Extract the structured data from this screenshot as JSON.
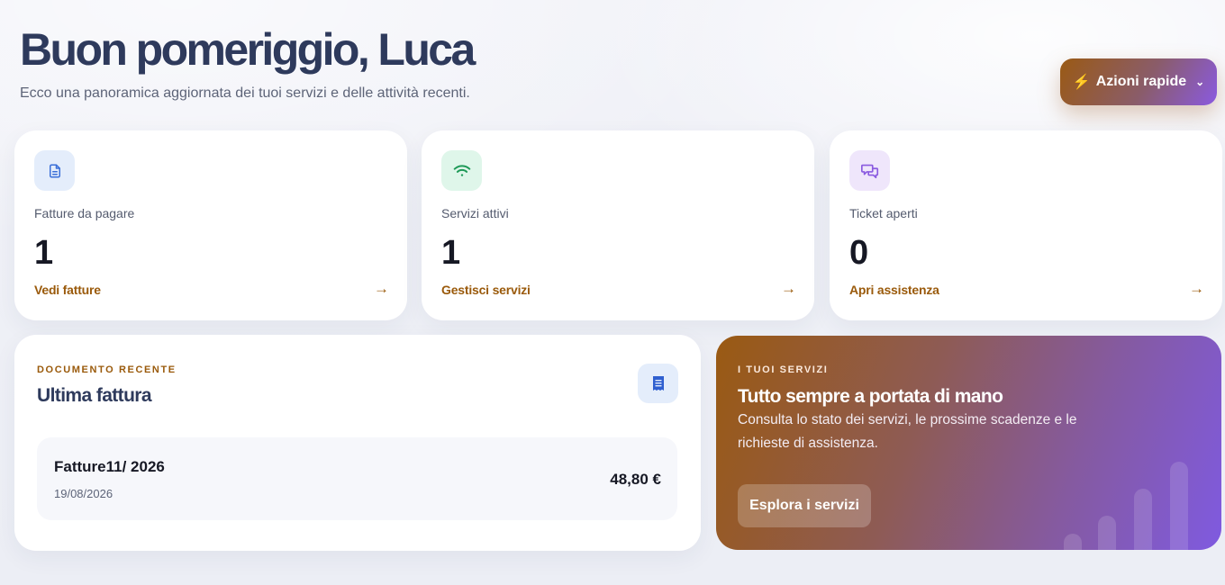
{
  "header": {
    "greeting": "Buon pomeriggio, Luca",
    "subtitle": "Ecco una panoramica aggiornata dei tuoi servizi e delle attività recenti.",
    "quick_actions_label": "Azioni rapide"
  },
  "stats": [
    {
      "label": "Fatture da pagare",
      "value": "1",
      "link": "Vedi fatture",
      "icon": "document-icon",
      "icon_bg": "#e4edfb",
      "icon_color": "#3a6fd8"
    },
    {
      "label": "Servizi attivi",
      "value": "1",
      "link": "Gestisci servizi",
      "icon": "wifi-icon",
      "icon_bg": "#dff6ea",
      "icon_color": "#1f9a58"
    },
    {
      "label": "Ticket aperti",
      "value": "0",
      "link": "Apri assistenza",
      "icon": "chat-bubbles-icon",
      "icon_bg": "#efe6fb",
      "icon_color": "#8a5ae0"
    }
  ],
  "recent_document": {
    "eyebrow": "Documento recente",
    "title": "Ultima fattura",
    "invoice_name": "Fatture11/ 2026",
    "invoice_date": "19/08/2026",
    "invoice_amount": "48,80 €"
  },
  "services_promo": {
    "eyebrow": "I tuoi servizi",
    "title": "Tutto sempre a portata di mano",
    "description": "Consulta lo stato dei servizi, le prossime scadenze e le richieste di assistenza.",
    "button_label": "Esplora i servizi"
  },
  "colors": {
    "accent": "#9a5a0b",
    "heading": "#2e3a5c",
    "gradient_start": "#9a5a12",
    "gradient_end": "#7f5ae0"
  }
}
